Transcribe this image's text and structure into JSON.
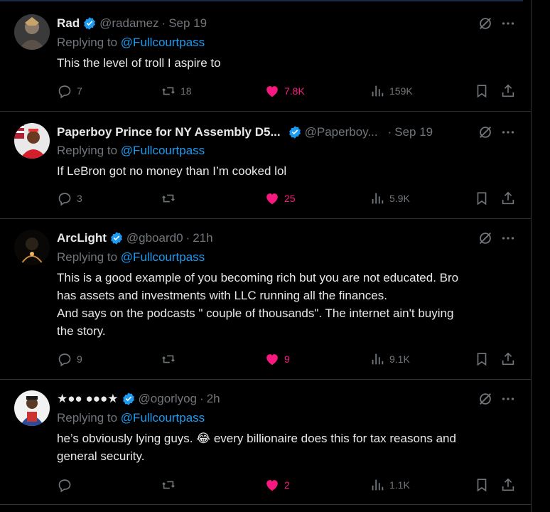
{
  "reply_prefix": "Replying to",
  "tweets": [
    {
      "name": "Rad",
      "handle": "@radamez",
      "sep": "·",
      "time": "Sep 19",
      "replying_to": "@Fullcourtpass",
      "lines": [
        "This the level of troll I aspire to"
      ],
      "replies": "7",
      "retweets": "18",
      "likes": "7.8K",
      "views": "159K"
    },
    {
      "name": "Paperboy Prince for NY Assembly D5...",
      "handle": "@Paperboy...",
      "sep": "·",
      "time": "Sep 19",
      "replying_to": "@Fullcourtpass",
      "lines": [
        "If LeBron got no money than I’m cooked lol"
      ],
      "replies": "3",
      "retweets": "",
      "likes": "25",
      "views": "5.9K"
    },
    {
      "name": "ArcLight",
      "handle": "@gboard0",
      "sep": "·",
      "time": "21h",
      "replying_to": "@Fullcourtpass",
      "lines": [
        "This is a good example of you becoming rich but you are not educated. Bro",
        "has assets and investments with LLC running all the finances.",
        "And says on the podcasts \" couple of thousands\".  The internet ain't buying",
        "the story."
      ],
      "replies": "9",
      "retweets": "",
      "likes": "9",
      "views": "9.1K"
    },
    {
      "name": "★●● ●●●★",
      "handle": "@ogorlyog",
      "sep": "·",
      "time": "2h",
      "replying_to": "@Fullcourtpass",
      "lines": [
        "he’s obviously lying guys. 😂 every billionaire does this for tax reasons and",
        "general security."
      ],
      "replies": "",
      "retweets": "",
      "likes": "2",
      "views": "1.1K"
    }
  ],
  "colors": {
    "accent": "#1d9bf0",
    "like": "#f91880",
    "muted": "#71767b",
    "text": "#e7e9ea",
    "border": "#2f3336"
  },
  "icons": [
    "verified-badge-icon",
    "grok-icon",
    "more-icon",
    "reply-icon",
    "retweet-icon",
    "heart-icon",
    "views-icon",
    "bookmark-icon",
    "share-icon"
  ]
}
